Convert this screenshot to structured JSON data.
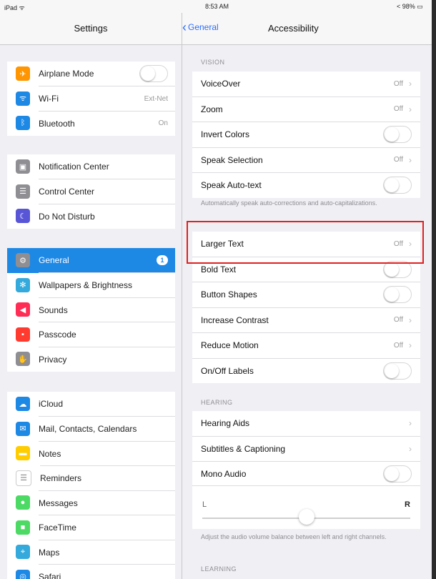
{
  "status_bar": {
    "left": "iPad ᯤ",
    "time": "8:53 AM",
    "right": "< 98% ▭"
  },
  "master": {
    "title": "Settings",
    "groups": [
      [
        {
          "label": "Airplane Mode",
          "icon": "airplane-icon",
          "color": "#ff9500",
          "glyph": "✈",
          "toggle": true
        },
        {
          "label": "Wi-Fi",
          "icon": "wifi-icon",
          "color": "#1e88e5",
          "glyph": "ᯤ",
          "value": "Ext-Net"
        },
        {
          "label": "Bluetooth",
          "icon": "bluetooth-icon",
          "color": "#1e88e5",
          "glyph": "ᛒ",
          "value": "On"
        }
      ],
      [
        {
          "label": "Notification Center",
          "icon": "notification-center-icon",
          "color": "#8e8e93",
          "glyph": "▣"
        },
        {
          "label": "Control Center",
          "icon": "control-center-icon",
          "color": "#8e8e93",
          "glyph": "☰"
        },
        {
          "label": "Do Not Disturb",
          "icon": "moon-icon",
          "color": "#5856d6",
          "glyph": "☾"
        }
      ],
      [
        {
          "label": "General",
          "icon": "gear-icon",
          "color": "#8e8e93",
          "glyph": "⚙",
          "badge": "1",
          "selected": true
        },
        {
          "label": "Wallpapers & Brightness",
          "icon": "brightness-icon",
          "color": "#34aadc",
          "glyph": "✻"
        },
        {
          "label": "Sounds",
          "icon": "sound-icon",
          "color": "#ff2d55",
          "glyph": "◀"
        },
        {
          "label": "Passcode",
          "icon": "lock-icon",
          "color": "#ff3b30",
          "glyph": "▪"
        },
        {
          "label": "Privacy",
          "icon": "hand-icon",
          "color": "#8e8e93",
          "glyph": "✋"
        }
      ],
      [
        {
          "label": "iCloud",
          "icon": "cloud-icon",
          "color": "#1e88e5",
          "glyph": "☁"
        },
        {
          "label": "Mail, Contacts, Calendars",
          "icon": "mail-icon",
          "color": "#1e88e5",
          "glyph": "✉"
        },
        {
          "label": "Notes",
          "icon": "notes-icon",
          "color": "#ffcc00",
          "glyph": "▬"
        },
        {
          "label": "Reminders",
          "icon": "reminders-icon",
          "color": "#ffffff",
          "glyph": "☰"
        },
        {
          "label": "Messages",
          "icon": "messages-icon",
          "color": "#4cd964",
          "glyph": "●"
        },
        {
          "label": "FaceTime",
          "icon": "facetime-icon",
          "color": "#4cd964",
          "glyph": "■"
        },
        {
          "label": "Maps",
          "icon": "maps-icon",
          "color": "#34aadc",
          "glyph": "⌖"
        },
        {
          "label": "Safari",
          "icon": "safari-icon",
          "color": "#1e88e5",
          "glyph": "◎"
        }
      ]
    ]
  },
  "detail": {
    "back": "General",
    "title": "Accessibility",
    "vision_header": "VISION",
    "vision": [
      {
        "label": "VoiceOver",
        "value": "Off",
        "chevron": true
      },
      {
        "label": "Zoom",
        "value": "Off",
        "chevron": true
      },
      {
        "label": "Invert Colors",
        "toggle": true
      },
      {
        "label": "Speak Selection",
        "value": "Off",
        "chevron": true
      },
      {
        "label": "Speak Auto-text",
        "toggle": true
      }
    ],
    "vision_note": "Automatically speak auto-corrections and auto-capitalizations.",
    "text": [
      {
        "label": "Larger Text",
        "value": "Off",
        "chevron": true
      },
      {
        "label": "Bold Text",
        "toggle": true
      },
      {
        "label": "Button Shapes",
        "toggle": true
      },
      {
        "label": "Increase Contrast",
        "value": "Off",
        "chevron": true
      },
      {
        "label": "Reduce Motion",
        "value": "Off",
        "chevron": true
      },
      {
        "label": "On/Off Labels",
        "toggle": true
      }
    ],
    "hearing_header": "HEARING",
    "hearing": [
      {
        "label": "Hearing Aids",
        "chevron": true
      },
      {
        "label": "Subtitles & Captioning",
        "chevron": true
      },
      {
        "label": "Mono Audio",
        "toggle": true
      }
    ],
    "balance": {
      "left": "L",
      "right": "R",
      "value": 0.5
    },
    "hearing_note": "Adjust the audio volume balance between left and right channels.",
    "learning_header": "LEARNING"
  },
  "highlight_color": "#e02020"
}
